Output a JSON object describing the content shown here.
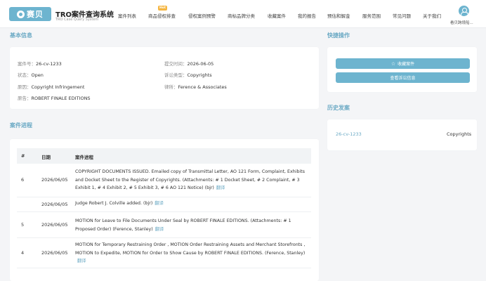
{
  "nav": {
    "logo_text": "赛贝",
    "brand_title": "TRO案件查询系统",
    "brand_subtitle": "TRO Case Query System",
    "hot_badge": "Hot",
    "menu": [
      "案件列表",
      "商品侵权排查",
      "侵权案例预警",
      "商标品牌分类",
      "收藏案件",
      "我的报告",
      "预估和解金",
      "服务范围",
      "常见问题",
      "关于我们"
    ],
    "user_name": "看贝跨境船..."
  },
  "basic_info": {
    "title": "基本信息",
    "case_no_label": "案件号：",
    "case_no": "26-cv-1233",
    "filed_label": "提交时间：",
    "filed": "2026-06-05",
    "status_label": "状态：",
    "status": "Open",
    "type_label": "诉讼类型：",
    "type": "Copyrights",
    "cause_label": "原因：",
    "cause": "Copyright Infringement",
    "lawfirm_label": "律所：",
    "lawfirm": "Ference & Associates",
    "plaintiff_label": "原告：",
    "plaintiff": "ROBERT FINALE EDITIONS"
  },
  "quick_actions": {
    "title": "快捷操作",
    "favorite_label": "收藏案件",
    "report_label": "查看诉讼信息"
  },
  "history": {
    "title": "历史发案",
    "items": [
      {
        "case": "26-cv-1233",
        "type": "Copyrights"
      }
    ]
  },
  "progress": {
    "title": "案件进程",
    "col_num": "#",
    "col_date": "日期",
    "col_text": "案件进程",
    "translate_label": "翻译",
    "rows": [
      {
        "num": "6",
        "date": "2026/06/05",
        "text": "COPYRIGHT DOCUMENTS ISSUED. Emailed copy of Transmittal Letter, AO 121 Form, Complaint, Exhibits and Docket Sheet to the Register of Copyrights. (Attachments: # 1 Docket Sheet, # 2 Complaint, # 3 Exhibit 1, # 4 Exhibit 2, # 5 Exhibit 3, # 6 AO 121 Notice) (bjr)"
      },
      {
        "num": "",
        "date": "2026/06/05",
        "text": "Judge Robert J. Colville added. (bjr)"
      },
      {
        "num": "5",
        "date": "2026/06/05",
        "text": "MOTION for Leave to File Documents Under Seal by ROBERT FINALE EDITIONS. (Attachments: # 1 Proposed Order) (Ference, Stanley)"
      },
      {
        "num": "4",
        "date": "2026/06/05",
        "text": "MOTION for Temporary Restraining Order , MOTION Order Restraining Assets and Merchant Storefronts , MOTION to Expedite, MOTION for Order to Show Cause by ROBERT FINALE EDITIONS. (Ference, Stanley)"
      }
    ]
  },
  "colors": {
    "accent": "#6db4cf",
    "link": "#6aa9c4",
    "hot": "#f5b642"
  }
}
